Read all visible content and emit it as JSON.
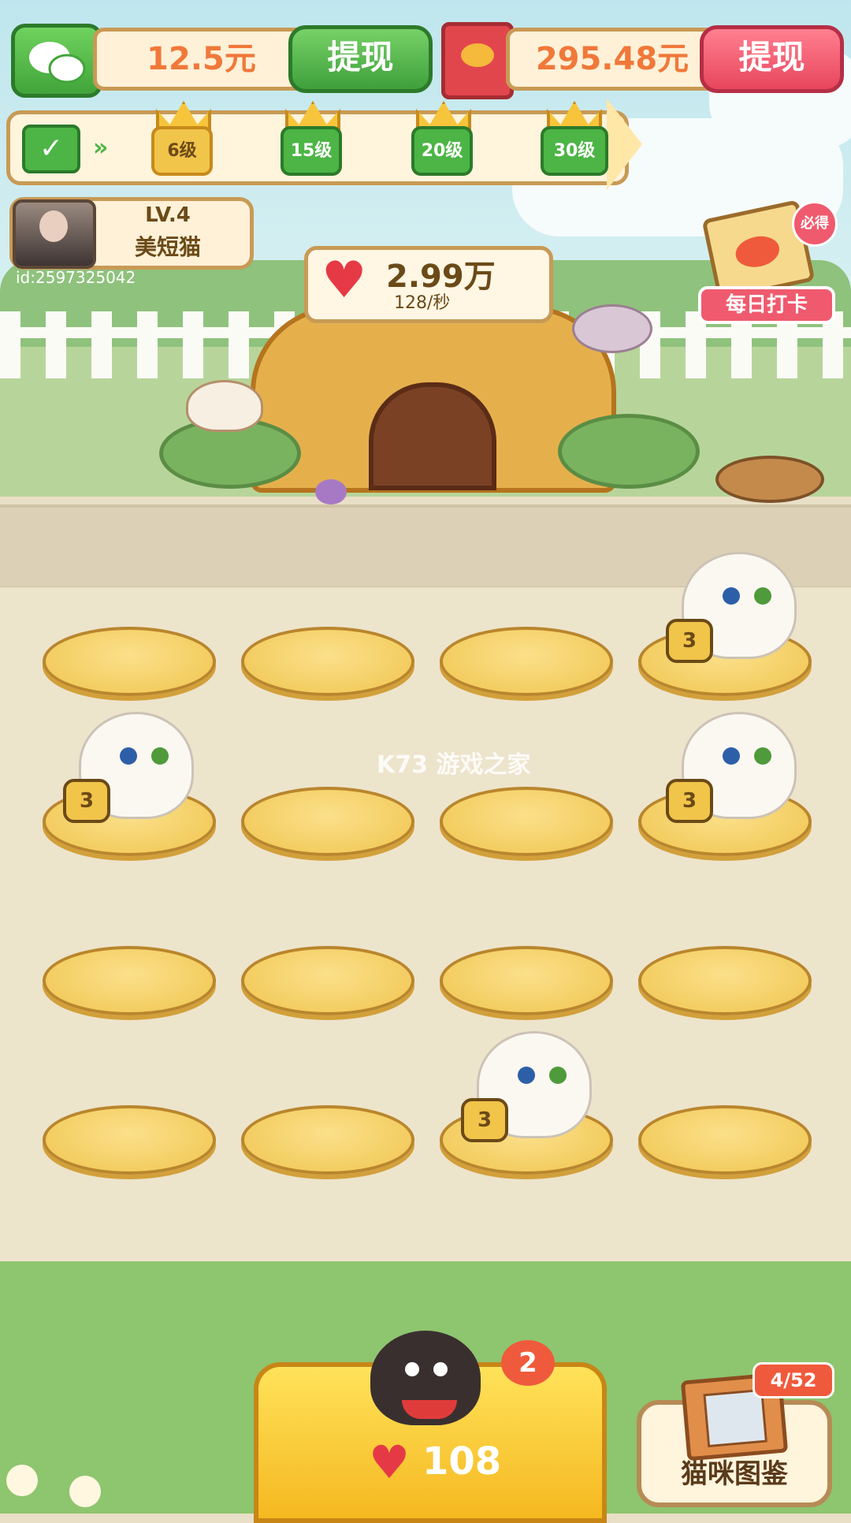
{
  "wallet": {
    "wechat_balance": "12.5元",
    "wechat_withdraw_label": "提现",
    "redpacket_balance": "295.48元",
    "redpacket_withdraw_label": "提现"
  },
  "level_progress": {
    "milestones": [
      "6级",
      "15级",
      "20级",
      "30级"
    ]
  },
  "profile": {
    "level": "LV.4",
    "cat_name": "美短猫",
    "user_id": "id:2597325042"
  },
  "hearts": {
    "total": "2.99万",
    "rate": "128/秒"
  },
  "daily_checkin": {
    "label": "每日打卡",
    "badge": "必得"
  },
  "board": {
    "cat_level": "3",
    "occupied_cells": [
      3,
      4,
      7,
      14
    ]
  },
  "buy_cat": {
    "price": "108",
    "badge_count": "2"
  },
  "collection": {
    "label": "猫咪图鉴",
    "count": "4/52"
  },
  "watermark": "K73 游戏之家"
}
